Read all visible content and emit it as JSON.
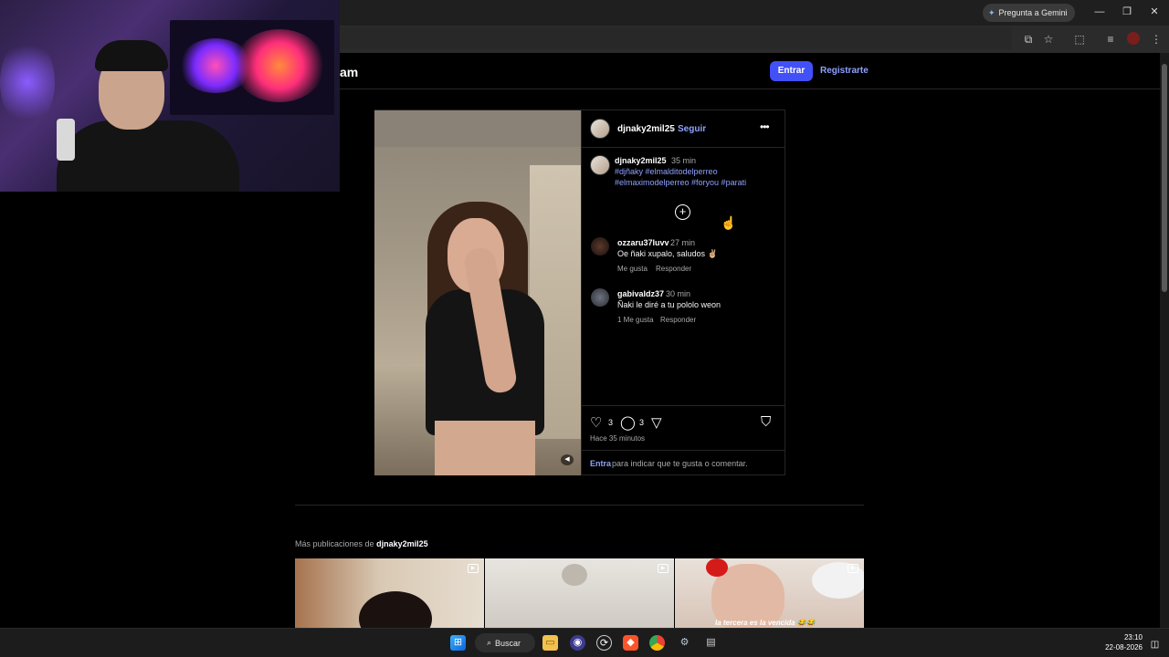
{
  "browser": {
    "gemini_button": "Pregunta a Gemini",
    "window_controls": [
      "minimize-icon",
      "restore-icon",
      "close-icon"
    ]
  },
  "page": {
    "logo_fragment": "am",
    "login_button": "Entrar",
    "signup_link": "Registrarte"
  },
  "post": {
    "username": "djnaky2mil25",
    "separator": "•",
    "follow": "Seguir",
    "caption": {
      "username": "djnaky2mil25",
      "time": "35 min",
      "tags_line1": "#djñaky #elmalditodelperreo",
      "tags_line2": "#elmaximodelperreo #foryou #parati"
    },
    "comments": [
      {
        "username": "ozzaru37luvv",
        "time": "27 min",
        "text": "Oe ñaki xupalo, saludos ✌🏼",
        "likes": "Me gusta",
        "reply": "Responder"
      },
      {
        "username": "gabivaldz37",
        "time": "30 min",
        "text": "Ñaki le diré a tu pololo weon",
        "likes": "1 Me gusta",
        "reply": "Responder"
      }
    ],
    "likes_count": "3",
    "comments_count": "3",
    "posted_ago": "Hace 35 minutos",
    "login_prompt_link": "Entra",
    "login_prompt_text": "para indicar que te gusta o comentar."
  },
  "more_posts": {
    "title_prefix": "Más publicaciones de",
    "title_user": "djnaky2mil25",
    "thumb3_caption": "la tercera es la vencida 😂😂"
  },
  "taskbar": {
    "search_label": "Buscar",
    "time": "23:10",
    "date": "22-08-2026"
  }
}
